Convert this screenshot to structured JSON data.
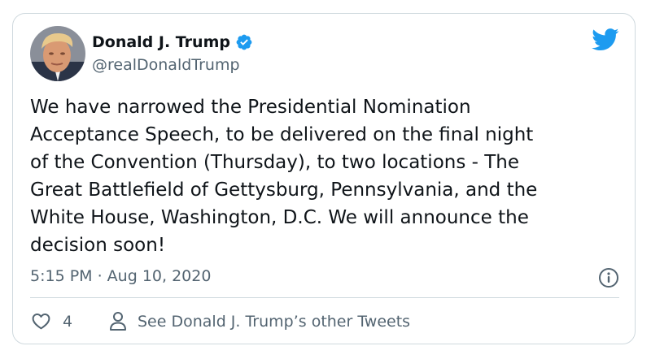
{
  "author": {
    "display_name": "Donald J. Trump",
    "handle": "@realDonaldTrump",
    "verified": true
  },
  "tweet": {
    "text": "We have narrowed the Presidential Nomination\nAcceptance Speech, to be delivered on the final night\nof the Convention (Thursday), to two locations - The\nGreat Battlefield of Gettysburg, Pennsylvania, and the\nWhite House, Washington, D.C. We will announce the\ndecision soon!",
    "timestamp": "5:15 PM · Aug 10, 2020"
  },
  "actions": {
    "like_count": "4",
    "profile_link_label": "See Donald J. Trump’s other Tweets"
  },
  "icons": {
    "verified_badge": "verified-badge-icon",
    "twitter_logo": "twitter-bird-icon",
    "info": "info-icon",
    "like": "heart-icon",
    "profile": "person-icon"
  },
  "colors": {
    "brand_blue": "#1d9bf0",
    "text": "#0f1419",
    "secondary_text": "#536471",
    "border": "#cfd9de"
  }
}
